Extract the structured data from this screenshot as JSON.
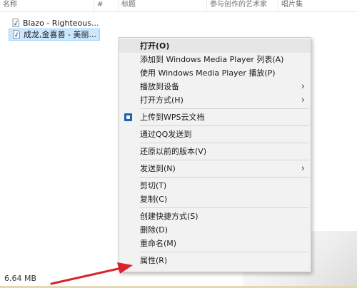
{
  "columns": [
    "名称",
    "#",
    "标题",
    "参与创作的艺术家",
    "唱片集"
  ],
  "files": [
    {
      "name": "Blazo - Righteous..."
    },
    {
      "name": "成龙,金喜善 - 美丽..."
    }
  ],
  "context_menu": {
    "open": "打开(O)",
    "add_to_wmp": "添加到 Windows Media Player 列表(A)",
    "play_with_wmp": "使用 Windows Media Player 播放(P)",
    "cast_to_device": "播放到设备",
    "open_with": "打开方式(H)",
    "upload_wps": "上传到WPS云文档",
    "send_via_qq": "通过QQ发送到",
    "restore_previous": "还原以前的版本(V)",
    "send_to": "发送到(N)",
    "cut": "剪切(T)",
    "copy": "复制(C)",
    "create_shortcut": "创建快捷方式(S)",
    "delete": "删除(D)",
    "rename": "重命名(M)",
    "properties": "属性(R)"
  },
  "status": {
    "size": "6.64 MB"
  },
  "colors": {
    "selection": "#cce8ff",
    "menu_bg": "#f2f2f2",
    "arrow": "#d9232d"
  }
}
